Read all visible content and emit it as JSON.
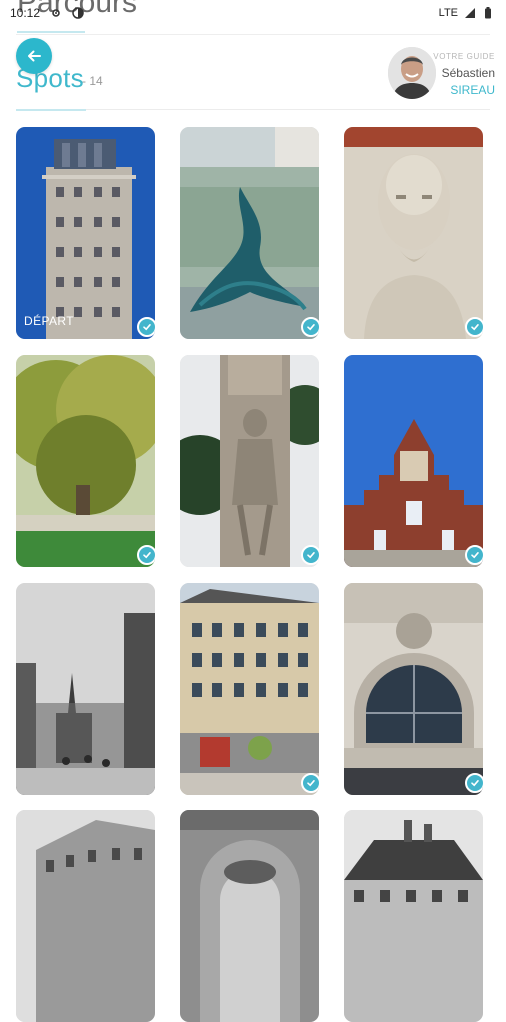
{
  "status": {
    "time": "10:12",
    "network": "LTE"
  },
  "header": {
    "parcours_title": "Parcours",
    "spots_title": "Spots",
    "spots_count": "- 14",
    "guide": {
      "label": "VOTRE GUIDE",
      "first_name": "Sébastien",
      "last_name": "SIREAU"
    }
  },
  "colors": {
    "accent": "#2cb7cc",
    "badge": "#43b5cc",
    "title": "#3fb8cc"
  },
  "spots": [
    {
      "id": 1,
      "image": "art-deco-tower",
      "label": "DÉPART",
      "visited": true
    },
    {
      "id": 2,
      "image": "wave-sculpture",
      "visited": true
    },
    {
      "id": 3,
      "image": "bearded-bust",
      "visited": true
    },
    {
      "id": 4,
      "image": "park-trees",
      "visited": true
    },
    {
      "id": 5,
      "image": "war-memorial-statue",
      "visited": true
    },
    {
      "id": 6,
      "image": "flemish-gable",
      "visited": true
    },
    {
      "id": 7,
      "image": "gothic-street",
      "visited": false
    },
    {
      "id": 8,
      "image": "haussmann-corner",
      "visited": true
    },
    {
      "id": 9,
      "image": "arched-window",
      "visited": true
    },
    {
      "id": 10,
      "image": "apartment-block-bw"
    },
    {
      "id": 11,
      "image": "ornate-arch"
    },
    {
      "id": 12,
      "image": "town-house-roof"
    }
  ]
}
